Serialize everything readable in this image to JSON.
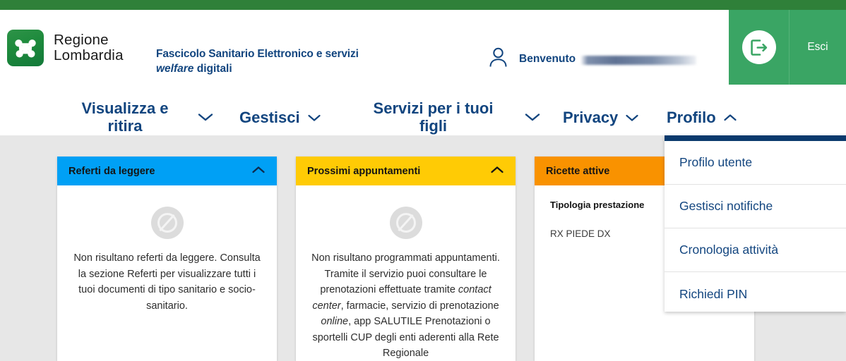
{
  "brand": {
    "logo_icon": "regione-lombardia-rose-camuna-icon",
    "name_line1": "Regione",
    "name_line2": "Lombardia",
    "subtitle_line1": "Fascicolo Sanitario Elettronico e servizi",
    "subtitle_line2_em": "welfare",
    "subtitle_line2_rest": " digitali"
  },
  "header": {
    "user_icon": "user-person-icon",
    "welcome_label": "Benvenuto",
    "welcome_name_redacted": "",
    "logout_icon": "logout-exit-door-icon",
    "logout_label": "Esci"
  },
  "nav": {
    "items": [
      {
        "label": "Visualizza e ritira",
        "chevron": "chevron-down-icon",
        "expanded": false
      },
      {
        "label": "Gestisci",
        "chevron": "chevron-down-icon",
        "expanded": false
      },
      {
        "label": "Servizi per i tuoi figli",
        "chevron": "chevron-down-icon",
        "expanded": false
      },
      {
        "label": "Privacy",
        "chevron": "chevron-down-icon",
        "expanded": false
      },
      {
        "label": "Profilo",
        "chevron": "chevron-up-icon",
        "expanded": true
      }
    ]
  },
  "dropdown": {
    "parent": "Profilo",
    "items": [
      {
        "label": "Profilo utente"
      },
      {
        "label": "Gestisci notifiche"
      },
      {
        "label": "Cronologia attività"
      },
      {
        "label": "Richiedi PIN"
      }
    ]
  },
  "cards": [
    {
      "title": "Referti da leggere",
      "accent": "#00a0f5",
      "collapse_icon": "chevron-up-icon",
      "empty_icon": "no-data-slashed-circle-icon",
      "empty_text": "Non risultano referti da leggere. Consulta la sezione Referti per visualizzare tutti i tuoi documenti di tipo sanitario e socio-sanitario."
    },
    {
      "title": "Prossimi appuntamenti",
      "accent": "#ffcb05",
      "collapse_icon": "chevron-up-icon",
      "empty_icon": "no-data-slashed-circle-icon",
      "empty_text_p1": "Non risultano programmati appuntamenti. Tramite il servizio puoi consultare le prenotazioni effettuate tramite ",
      "empty_text_em1": "contact center",
      "empty_text_p2": ", farmacie, servizio di prenotazione ",
      "empty_text_em2": "online",
      "empty_text_p3": ", app SALUTILE Prenotazioni o sportelli CUP degli enti aderenti alla Rete Regionale"
    },
    {
      "title": "Ricette attive",
      "accent": "#f99200",
      "column_header": "Tipologia prestazione",
      "rows": [
        "RX PIEDE DX"
      ]
    }
  ],
  "colors": {
    "top_strip_green": "#2f8039",
    "logout_green": "#3aa564",
    "nav_blue": "#12457f",
    "dropdown_border": "#0b3a6d",
    "page_bg": "#e7e7e7"
  }
}
